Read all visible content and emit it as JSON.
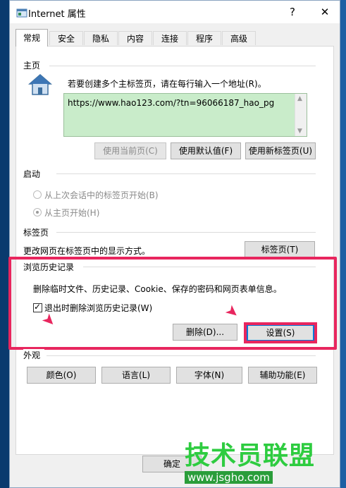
{
  "window": {
    "title": "Internet 属性",
    "help": "?",
    "close": "✕"
  },
  "tabs": [
    "常规",
    "安全",
    "隐私",
    "内容",
    "连接",
    "程序",
    "高级"
  ],
  "homepage": {
    "section": "主页",
    "instruction": "若要创建多个主标签页，请在每行输入一个地址(R)。",
    "url": "https://www.hao123.com/?tn=96066187_hao_pg",
    "use_current": "使用当前页(C)",
    "use_default": "使用默认值(F)",
    "use_new_tab": "使用新标签页(U)"
  },
  "startup": {
    "section": "启动",
    "opt_last_session": "从上次会话中的标签页开始(B)",
    "opt_homepage": "从主页开始(H)"
  },
  "tabs_section": {
    "section": "标签页",
    "desc": "更改网页在标签页中的显示方式。",
    "button": "标签页(T)"
  },
  "history": {
    "section": "浏览历史记录",
    "desc": "删除临时文件、历史记录、Cookie、保存的密码和网页表单信息。",
    "delete_on_exit": "退出时删除浏览历史记录(W)",
    "delete_on_exit_checked": true,
    "delete_button": "删除(D)...",
    "settings_button": "设置(S)"
  },
  "appearance": {
    "section": "外观",
    "colors": "颜色(O)",
    "languages": "语言(L)",
    "fonts": "字体(N)",
    "accessibility": "辅助功能(E)"
  },
  "footer": {
    "ok": "确定"
  },
  "watermark": {
    "text": "技术员联盟",
    "url": "www.jsgho.com"
  },
  "colors": {
    "highlight": "#e8265e",
    "homepage_bg": "#c9ecca",
    "focus": "#0078d7"
  }
}
